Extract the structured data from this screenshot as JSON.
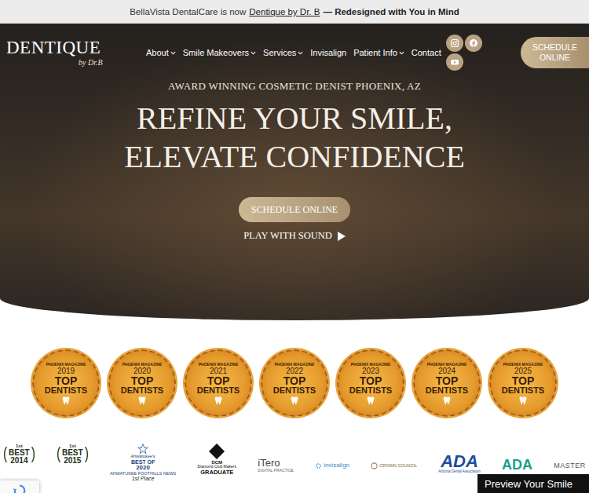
{
  "banner": {
    "prefix": "BellaVista DentalCare is now",
    "link": "Dentique by Dr. B",
    "suffix": "— Redesigned with You in Mind"
  },
  "logo": {
    "name": "DENTIQUE",
    "byline": "by Dr.B"
  },
  "nav": [
    {
      "label": "About",
      "dropdown": true
    },
    {
      "label": "Smile Makeovers",
      "dropdown": true
    },
    {
      "label": "Services",
      "dropdown": true
    },
    {
      "label": "Invisalign",
      "dropdown": false
    },
    {
      "label": "Patient Info",
      "dropdown": true
    },
    {
      "label": "Contact",
      "dropdown": false
    }
  ],
  "header_button": "SCHEDULE ONLINE",
  "hero": {
    "kicker": "AWARD WINNING COSMETIC DENIST PHOENIX, AZ",
    "title": [
      "REFINE YOUR SMILE,",
      "ELEVATE CONFIDENCE"
    ],
    "button": "SCHEDULE ONLINE",
    "play": "PLAY WITH SOUND"
  },
  "badges": [
    {
      "magazine": "PHOENIX MAGAZINE",
      "year": "2019",
      "title": [
        "TOP",
        "DENTISTS"
      ]
    },
    {
      "magazine": "PHOENIX MAGAZINE",
      "year": "2020",
      "title": [
        "TOP",
        "DENTISTS"
      ]
    },
    {
      "magazine": "PHOENIX MAGAZINE",
      "year": "2021",
      "title": [
        "TOP",
        "DENTISTS"
      ]
    },
    {
      "magazine": "PHOENIX MAGAZINE",
      "year": "2022",
      "title": [
        "TOP",
        "DENTISTS"
      ]
    },
    {
      "magazine": "PHOENIX MAGAZINE",
      "year": "2023",
      "title": [
        "TOP",
        "DENTISTS"
      ]
    },
    {
      "magazine": "PHOENIX MAGAZINE",
      "year": "2024",
      "title": [
        "TOP",
        "DENTISTS"
      ]
    },
    {
      "magazine": "PHOENIX MAGAZINE",
      "year": "2025",
      "title": [
        "TOP",
        "DENTISTS"
      ]
    }
  ],
  "logos": [
    {
      "kind": "laurel",
      "lines": [
        "1st",
        "BEST",
        "2014"
      ]
    },
    {
      "kind": "laurel",
      "lines": [
        "1st",
        "BEST",
        "2015"
      ]
    },
    {
      "kind": "star",
      "lines": [
        "Ahwatukee's",
        "BEST OF",
        "2020",
        "AHWATUKEE FOOTHILLS NEWS",
        "1st Place"
      ]
    },
    {
      "kind": "diamond",
      "lines": [
        "DCM",
        "Diamond Club Makers",
        "GRADUATE"
      ]
    },
    {
      "kind": "itero",
      "lines": [
        "iTero",
        "DIGITAL PRACTICE"
      ]
    },
    {
      "kind": "invisalign",
      "lines": [
        "invisalign"
      ]
    },
    {
      "kind": "crown",
      "lines": [
        "CROWN COUNCIL"
      ]
    },
    {
      "kind": "aza",
      "lines": [
        "ADA",
        "Arizona Dental Association"
      ]
    },
    {
      "kind": "ada",
      "lines": [
        "ADA"
      ]
    },
    {
      "kind": "master",
      "lines": [
        "MASTER"
      ]
    }
  ],
  "preview_button": "Preview Your Smile"
}
